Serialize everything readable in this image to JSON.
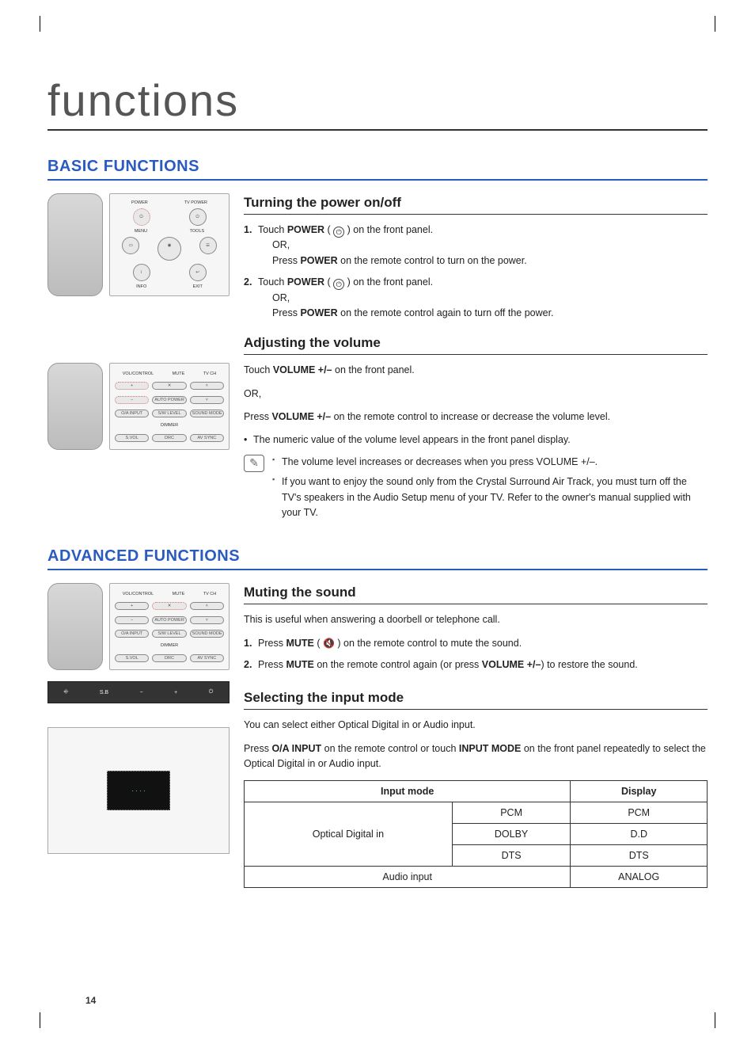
{
  "page": {
    "title": "functions",
    "number": "14"
  },
  "basic": {
    "heading": "BASIC FUNCTIONS",
    "remote1_labels": {
      "power": "POWER",
      "tvpower": "TV POWER",
      "menu": "MENU",
      "tools": "TOOLS",
      "info": "INFO",
      "exit": "EXIT"
    },
    "remote2_labels": {
      "col1": "VOL/CONTROL",
      "col2": "MUTE",
      "col3": "TV CH",
      "plus": "+",
      "mute": "✕",
      "up": "˄",
      "minus": "−",
      "auto": "AUTO POWER",
      "down": "˅",
      "oa": "O/A INPUT",
      "sw": "S/W LEVEL",
      "snd": "SOUND MODE",
      "dimmer": "DIMMER",
      "svol": "S.VOL",
      "drc": "DRC",
      "av": "AV SYNC"
    },
    "power": {
      "heading": "Turning the power on/off",
      "s1a": "Touch ",
      "s1b": "POWER",
      "s1c": " ( ",
      "s1d": " ) on the front panel.",
      "s1or": "OR,",
      "s1e": "Press ",
      "s1f": "POWER",
      "s1g": " on the remote control to turn on the power.",
      "s2a": "Touch ",
      "s2b": "POWER",
      "s2c": " ( ",
      "s2d": " ) on the front panel.",
      "s2or": "OR,",
      "s2e": "Press ",
      "s2f": "POWER",
      "s2g": " on the remote control again to turn off the power."
    },
    "volume": {
      "heading": "Adjusting the volume",
      "p1a": "Touch ",
      "p1b": "VOLUME +/–",
      "p1c": " on the front panel.",
      "or": "OR,",
      "p2a": "Press ",
      "p2b": "VOLUME +/–",
      "p2c": " on the remote control to increase or decrease the volume level.",
      "b1": "The numeric value of the volume level appears in the front panel display.",
      "n1": "The volume level increases or decreases when you press VOLUME +/–.",
      "n2": "If you want to enjoy the sound only from the Crystal Surround Air Track, you must turn off the TV's speakers in the Audio Setup menu of your TV. Refer to the owner's manual supplied with your TV."
    }
  },
  "advanced": {
    "heading": "ADVANCED FUNCTIONS",
    "mute": {
      "heading": "Muting the sound",
      "p1": "This is useful when answering a doorbell or telephone call.",
      "s1a": "Press ",
      "s1b": "MUTE",
      "s1c": " ( ",
      "s1d": " ) on the remote control to mute the sound.",
      "s2a": "Press ",
      "s2b": "MUTE",
      "s2c": " on the remote control again (or press ",
      "s2d": "VOLUME +/–",
      "s2e": ") to restore the sound."
    },
    "input": {
      "heading": "Selecting the input mode",
      "p1": "You can select either Optical Digital in or Audio input.",
      "p2a": "Press ",
      "p2b": "O/A INPUT",
      "p2c": " on the remote control or touch ",
      "p2d": "INPUT MODE",
      "p2e": " on the front panel repeatedly to select the Optical Digital in or Audio input.",
      "th1": "Input mode",
      "th2": "Display",
      "r1c1": "Optical Digital in",
      "r1c2": "PCM",
      "r1c3": "PCM",
      "r2c2": "DOLBY",
      "r2c3": "D.D",
      "r3c2": "DTS",
      "r3c3": "DTS",
      "r4c1": "Audio input",
      "r4c3": "ANALOG"
    },
    "device": {
      "bar_items": [
        "⎆",
        "S.B",
        "−",
        "+",
        "⏻"
      ],
      "screen": "· · · ·"
    }
  }
}
